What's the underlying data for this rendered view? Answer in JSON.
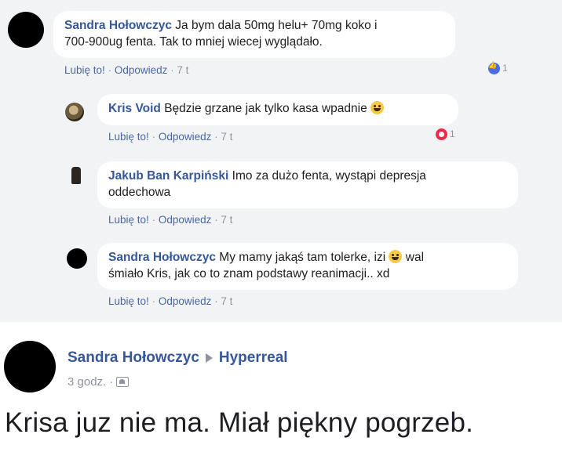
{
  "comments": [
    {
      "author": "Sandra Hołowczyc",
      "text_line1": "Ja bym dala 50mg helu+ 70mg koko i",
      "text_line2": "700-900ug fenta. Tak to mniej wiecej wyglądało.",
      "like": "Lubię to!",
      "reply": "Odpowiedz",
      "time": "7 t",
      "reactions": {
        "type": "like",
        "count": "1"
      }
    },
    {
      "author": "Kris Void",
      "text": "Będzie grzane jak tylko kasa wpadnie",
      "emoji": "grinning-emoji",
      "like": "Lubię to!",
      "reply": "Odpowiedz",
      "time": "7 t",
      "reactions": {
        "type": "love",
        "count": "1"
      }
    },
    {
      "author": "Jakub Ban Karpiński",
      "text_line1": "Imo za dużo fenta, wystąpi depresja",
      "text_line2": "oddechowa",
      "like": "Lubię to!",
      "reply": "Odpowiedz",
      "time": "7 t"
    },
    {
      "author": "Sandra Hołowczyc",
      "text_line1a": "My mamy jakąś tam tolerke, izi",
      "text_line1b": "wal",
      "emoji": "grinning-emoji",
      "text_line2": "śmiało Kris, jak co to znam podstawy reanimacji.. xd",
      "like": "Lubię to!",
      "reply": "Odpowiedz",
      "time": "7 t"
    }
  ],
  "post": {
    "author": "Sandra Hołowczyc",
    "group": "Hyperreal",
    "time": "3 godz.",
    "privacy_icon": "group-icon",
    "text": "Krisa juz nie ma. Miał piękny pogrzeb."
  },
  "colors": {
    "link": "#365899",
    "meta": "#90949c",
    "thread_bg": "#f2f3f5"
  }
}
